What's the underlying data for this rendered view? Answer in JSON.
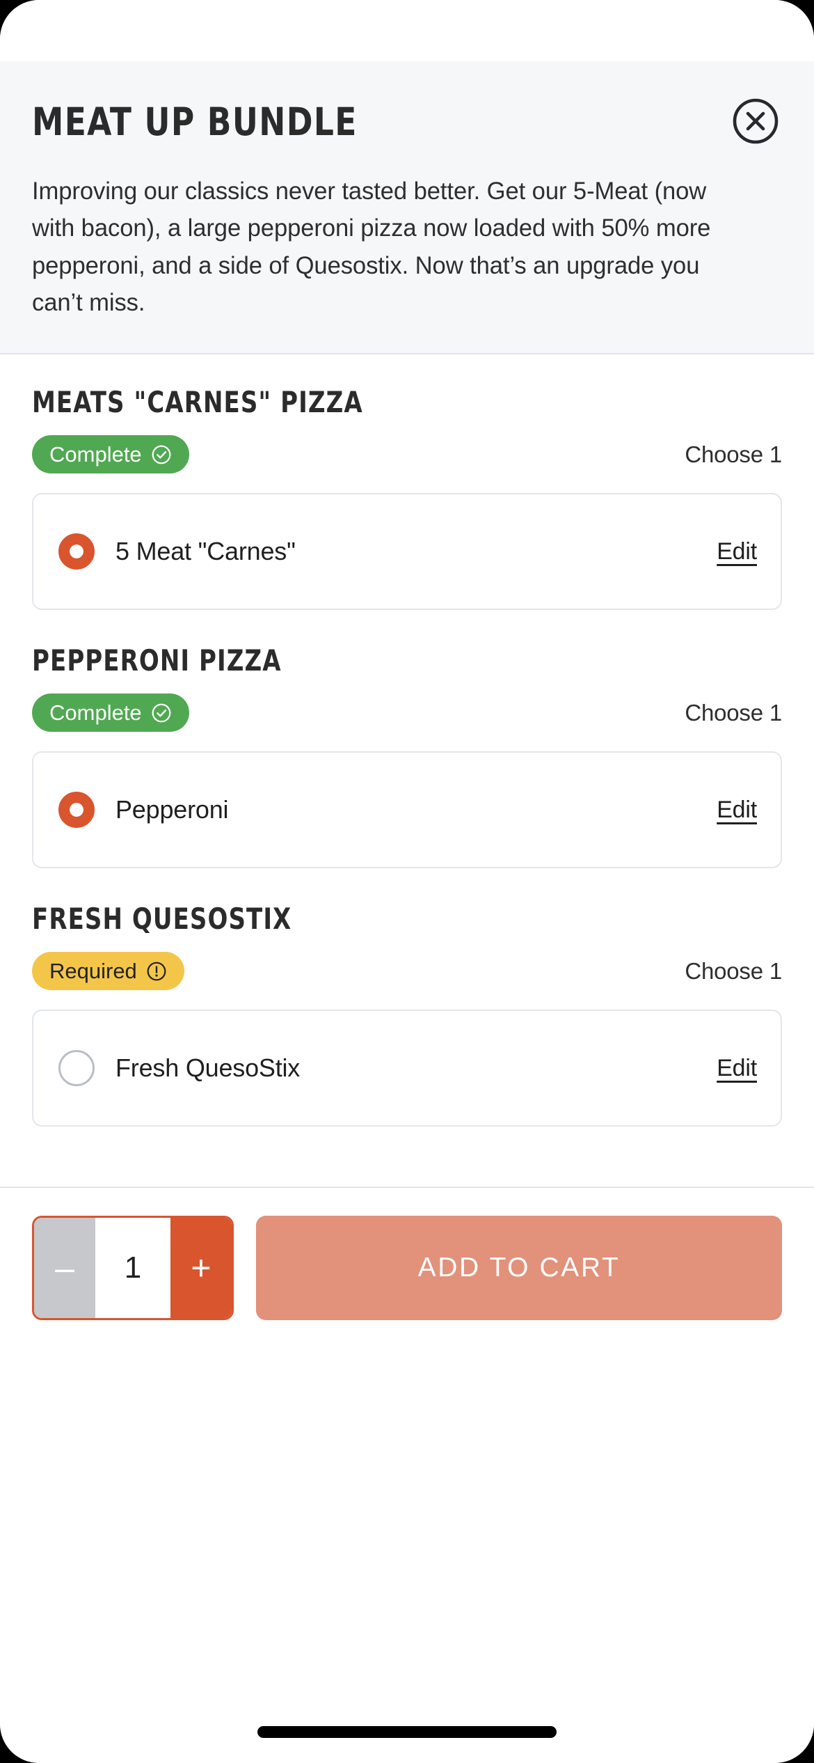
{
  "header": {
    "title": "Meat Up Bundle",
    "close_icon": "close-circle-icon",
    "description": "Improving our classics never tasted better. Get our 5-Meat (now with bacon), a large pepperoni pizza now loaded with 50% more pepperoni, and a side of Quesostix. Now that’s an upgrade you can’t miss."
  },
  "groups": [
    {
      "title": "Meats \"Carnes\" Pizza",
      "status_label": "Complete",
      "status_type": "complete",
      "status_icon": "check-circle-icon",
      "choose_text": "Choose 1",
      "option_label": "5 Meat \"Carnes\"",
      "option_selected": true,
      "edit_label": "Edit"
    },
    {
      "title": "Pepperoni Pizza",
      "status_label": "Complete",
      "status_type": "complete",
      "status_icon": "check-circle-icon",
      "choose_text": "Choose 1",
      "option_label": "Pepperoni",
      "option_selected": true,
      "edit_label": "Edit"
    },
    {
      "title": "Fresh Quesostix",
      "status_label": "Required",
      "status_type": "required",
      "status_icon": "exclamation-circle-icon",
      "choose_text": "Choose 1",
      "option_label": "Fresh QuesoStix",
      "option_selected": false,
      "edit_label": "Edit"
    }
  ],
  "footer": {
    "decrement_label": "–",
    "quantity": "1",
    "increment_label": "+",
    "add_to_cart_label": "Add to Cart"
  },
  "colors": {
    "accent_orange": "#d9552e",
    "complete_green": "#50a852",
    "required_yellow": "#f3c64a",
    "add_cart_disabled": "#e2917a",
    "header_bg": "#f6f7f9",
    "border": "#e3e6eb"
  }
}
